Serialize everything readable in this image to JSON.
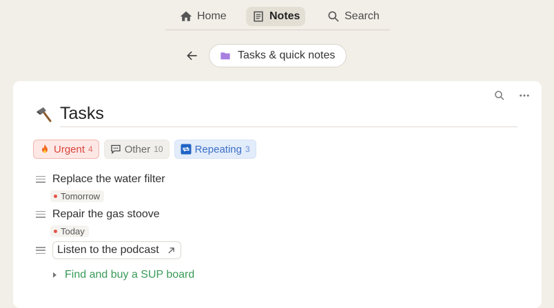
{
  "nav": {
    "home": "Home",
    "notes": "Notes",
    "search": "Search"
  },
  "breadcrumb": {
    "label": "Tasks & quick notes",
    "icon": "folder-icon",
    "icon_color": "#a77fe0"
  },
  "page": {
    "title": "Tasks",
    "title_icon": "hammer-icon"
  },
  "tags": [
    {
      "label": "Urgent",
      "count": "4",
      "icon": "fire-icon",
      "color": "#d9453c"
    },
    {
      "label": "Other",
      "count": "10",
      "icon": "speech-bubble-icon",
      "color": "#6a6a6a"
    },
    {
      "label": "Repeating",
      "count": "3",
      "icon": "repeat-icon",
      "color": "#3c6fc7"
    }
  ],
  "tasks": [
    {
      "text": "Replace the water filter",
      "due": "Tomorrow"
    },
    {
      "text": "Repair the gas stoove",
      "due": "Today"
    },
    {
      "text": "Listen to the podcast"
    }
  ],
  "project": {
    "text": "Find and buy a SUP board",
    "color": "#3a9a58"
  }
}
